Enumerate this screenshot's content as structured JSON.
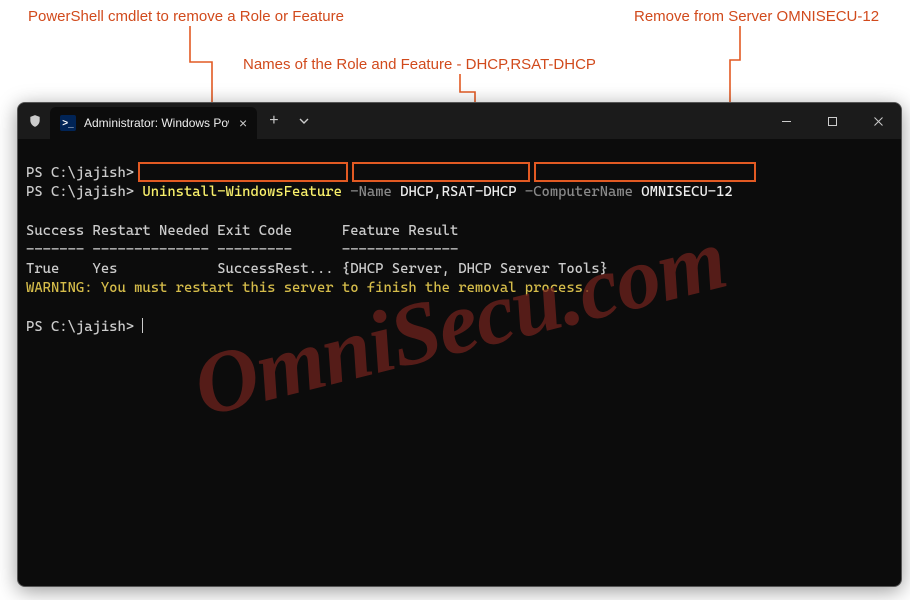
{
  "annotations": {
    "cmdlet": "PowerShell cmdlet to remove a Role or Feature",
    "names": "Names of the Role and Feature - DHCP,RSAT-DHCP",
    "server": "Remove from Server OMNISECU-12"
  },
  "tab": {
    "title": "Administrator: Windows Powe",
    "icon_text": ">_"
  },
  "terminal": {
    "prompt": "PS C:\\jajish>",
    "cmd_verb": "Uninstall-WindowsFeature",
    "cmd_param1": "-Name",
    "cmd_arg1": "DHCP,RSAT-DHCP",
    "cmd_param2": "-ComputerName",
    "cmd_arg2": "OMNISECU-12",
    "header": "Success Restart Needed Exit Code      Feature Result",
    "divider": "------- -------------- ---------      --------------",
    "row": "True    Yes            SuccessRest... {DHCP Server, DHCP Server Tools}",
    "warning": "WARNING: You must restart this server to finish the removal process."
  },
  "watermark": "OmniSecu.com"
}
